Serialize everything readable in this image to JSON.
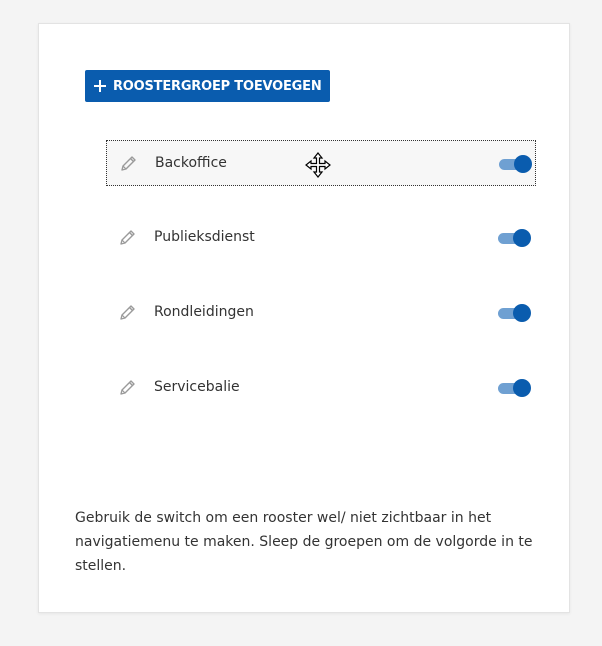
{
  "toolbar": {
    "add_group_label": "ROOSTERGROEP TOEVOEGEN"
  },
  "groups": [
    {
      "label": "Backoffice",
      "enabled": true,
      "selected": true
    },
    {
      "label": "Publieksdienst",
      "enabled": true,
      "selected": false
    },
    {
      "label": "Rondleidingen",
      "enabled": true,
      "selected": false
    },
    {
      "label": "Servicebalie",
      "enabled": true,
      "selected": false
    }
  ],
  "help_text": "Gebruik de switch om een rooster wel/ niet zichtbaar in het navigatiemenu te maken. Sleep de groepen om de volgorde in te stellen.",
  "colors": {
    "accent": "#0a5cae",
    "toggle_track": "#6fa0d2",
    "text": "#333333",
    "background": "#f4f4f4"
  },
  "icons": {
    "add": "plus-icon",
    "edit": "pencil-icon",
    "cursor": "move-cursor-icon"
  }
}
